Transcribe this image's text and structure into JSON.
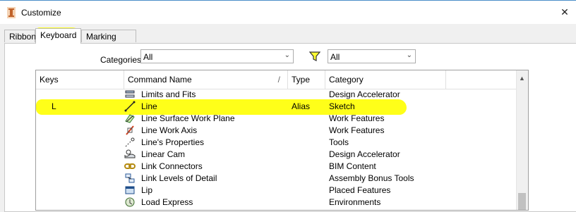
{
  "window": {
    "title": "Customize",
    "close_symbol": "✕"
  },
  "tabs": [
    {
      "label": "Ribbon",
      "active": false
    },
    {
      "label": "Keyboard",
      "active": true
    },
    {
      "label": "Marking Menu",
      "active": false
    }
  ],
  "filters": {
    "categories_label": "Categories",
    "categories_value": "All",
    "type_filter_value": "All"
  },
  "grid": {
    "columns": [
      "Keys",
      "Command Name",
      "Type",
      "Category"
    ],
    "sort_indicator": "/",
    "rows": [
      {
        "keys": "",
        "command": "Limits and Fits",
        "type": "",
        "category": "Design Accelerator",
        "icon": "limits-and-fits-icon"
      },
      {
        "keys": "L",
        "command": "Line",
        "type": "Alias",
        "category": "Sketch",
        "icon": "line-icon"
      },
      {
        "keys": "",
        "command": "Line Surface Work Plane",
        "type": "",
        "category": "Work Features",
        "icon": "work-plane-icon"
      },
      {
        "keys": "",
        "command": "Line Work Axis",
        "type": "",
        "category": "Work Features",
        "icon": "work-axis-icon"
      },
      {
        "keys": "",
        "command": "Line's Properties",
        "type": "",
        "category": "Tools",
        "icon": "line-properties-icon"
      },
      {
        "keys": "",
        "command": "Linear Cam",
        "type": "",
        "category": "Design Accelerator",
        "icon": "linear-cam-icon"
      },
      {
        "keys": "",
        "command": "Link Connectors",
        "type": "",
        "category": "BIM Content",
        "icon": "link-connectors-icon"
      },
      {
        "keys": "",
        "command": "Link Levels of Detail",
        "type": "",
        "category": "Assembly Bonus Tools",
        "icon": "link-levels-icon"
      },
      {
        "keys": "",
        "command": "Lip",
        "type": "",
        "category": "Placed Features",
        "icon": "lip-icon"
      },
      {
        "keys": "",
        "command": "Load Express",
        "type": "",
        "category": "Environments",
        "icon": "load-express-icon"
      }
    ]
  },
  "colors": {
    "highlight": "#ffff00",
    "accent": "#4b8ec8"
  }
}
